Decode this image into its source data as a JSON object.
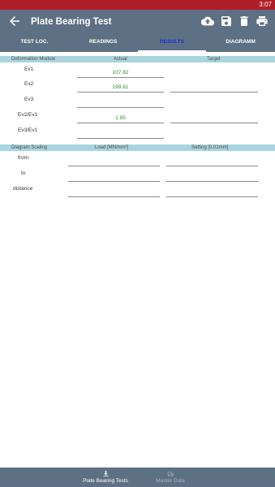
{
  "status": {
    "time": "3:07"
  },
  "header": {
    "title": "Plate Bearing Test"
  },
  "tabs": [
    {
      "label": "TEST LOC."
    },
    {
      "label": "READINGS"
    },
    {
      "label": "RESULTS"
    },
    {
      "label": "DIAGRAMM"
    }
  ],
  "deformation": {
    "heading": "Deformation Module",
    "actual_label": "Actual",
    "target_label": "Target",
    "rows": [
      {
        "label": "Ev1",
        "actual": "107.82",
        "target": ""
      },
      {
        "label": "Ev2",
        "actual": "199.81",
        "target": ""
      },
      {
        "label": "Ev3",
        "actual": "",
        "target": ""
      },
      {
        "label": "Ev2/Ev1",
        "actual": "1.85",
        "target": ""
      },
      {
        "label": "Ev3/Ev1",
        "actual": "",
        "target": ""
      }
    ]
  },
  "scaling": {
    "heading": "Diagram Scaling",
    "load_label": "Load [MN/mm²]",
    "setting_label": "Setting [0.01mm]",
    "rows": [
      {
        "label": "from",
        "load": "",
        "setting": ""
      },
      {
        "label": "to",
        "load": "",
        "setting": ""
      },
      {
        "label": "distance",
        "load": "",
        "setting": ""
      }
    ]
  },
  "bottom_nav": [
    {
      "label": "Plate Bearing Tests",
      "icon": "download-icon"
    },
    {
      "label": "Master Data",
      "icon": "truck-icon"
    }
  ],
  "colors": {
    "status_bar": "#b01e2a",
    "app_bar": "#5e7184",
    "section_header": "#a9d5df",
    "active_tab": "#1a2fd6",
    "value_text": "#2e8b2e"
  }
}
